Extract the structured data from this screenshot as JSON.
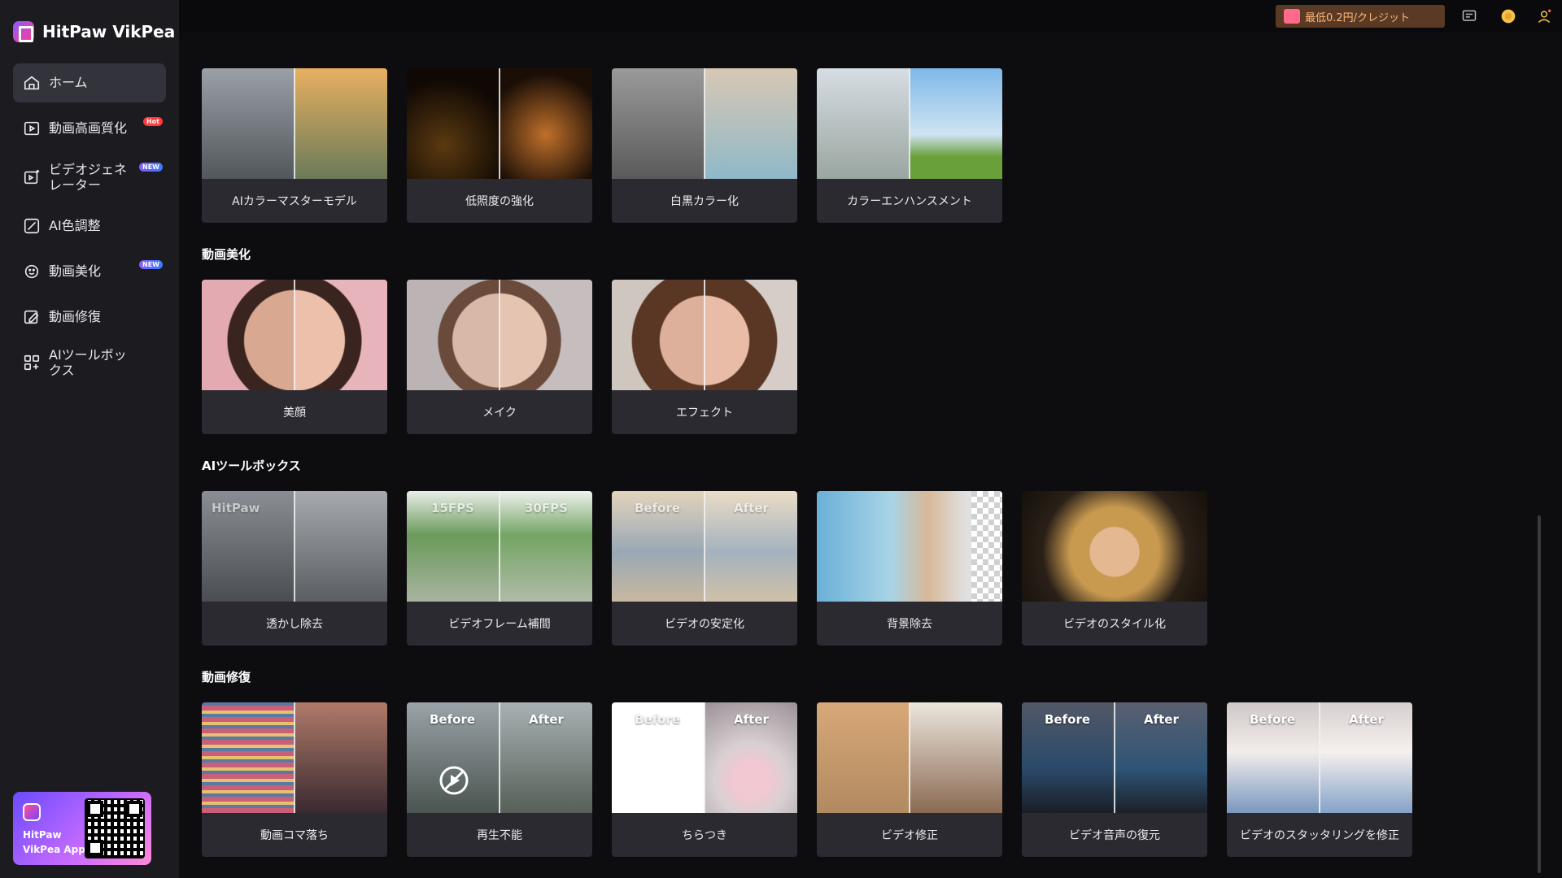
{
  "app": {
    "name": "HitPaw VikPea"
  },
  "sidebar": {
    "items": [
      {
        "label": "ホーム",
        "icon": "home-icon",
        "active": true
      },
      {
        "label": "動画高画質化",
        "icon": "video-enhance-icon",
        "badge": "Hot"
      },
      {
        "label": "ビデオジェネレーター",
        "icon": "video-generator-icon",
        "badge": "NEW"
      },
      {
        "label": "AI色調整",
        "icon": "color-adjust-icon"
      },
      {
        "label": "動画美化",
        "icon": "beautify-icon",
        "badge": "NEW"
      },
      {
        "label": "動画修復",
        "icon": "repair-icon"
      },
      {
        "label": "AIツールボックス",
        "icon": "toolbox-icon"
      }
    ],
    "app_promo": {
      "line1": "HitPaw",
      "line2": "VikPea App"
    }
  },
  "topbar": {
    "promo_text": "最低0.2円/クレジット"
  },
  "sections": [
    {
      "title": "",
      "cards": [
        {
          "label": "AIカラーマスターモデル",
          "left": "#6f7378",
          "right": "#c88a3a"
        },
        {
          "label": "低照度の強化",
          "left": "#1a120a",
          "right": "#3a2410"
        },
        {
          "label": "白黒カラー化",
          "left": "#8b8b8b",
          "right": "#d8d0c4"
        },
        {
          "label": "カラーエンハンスメント",
          "left": "#c7ced6",
          "right": "#8fbfe8"
        }
      ]
    },
    {
      "title": "動画美化",
      "cards": [
        {
          "label": "美顔",
          "left": "#d9a3a8",
          "right": "#e8b4bc"
        },
        {
          "label": "メイク",
          "left": "#c9b8b0",
          "right": "#d6c2b8"
        },
        {
          "label": "エフェクト",
          "left": "#8a6a56",
          "right": "#b08a70"
        }
      ]
    },
    {
      "title": "AIツールボックス",
      "cards": [
        {
          "label": "透かし除去",
          "left": "#6d7076",
          "right": "#8c8f96",
          "tag_left": "HitPaw"
        },
        {
          "label": "ビデオフレーム補間",
          "left": "#7aa06a",
          "right": "#8fb47c",
          "tag_left": "15FPS",
          "tag_right": "30FPS"
        },
        {
          "label": "ビデオの安定化",
          "left": "#b7aa96",
          "right": "#cbbfae",
          "tag_left": "Before",
          "tag_right": "After"
        },
        {
          "label": "背景除去",
          "left": "#7fb7d4",
          "right": "#e6e6e6"
        },
        {
          "label": "ビデオのスタイル化",
          "left": "#3a2a1a",
          "right": "#5a4028"
        }
      ]
    },
    {
      "title": "動画修復",
      "cards": [
        {
          "label": "動画コマ落ち",
          "left": "#7a5a6a",
          "right": "#9a6a5a"
        },
        {
          "label": "再生不能",
          "left": "#6a7470",
          "right": "#7c8680",
          "tag_left": "Before",
          "tag_right": "After"
        },
        {
          "label": "ちらつき",
          "left": "#ffffff",
          "right": "#d7c7cc",
          "tag_left": "Before",
          "tag_right": "After"
        },
        {
          "label": "ビデオ修正",
          "left": "#c9a27a",
          "right": "#e6e0d8"
        },
        {
          "label": "ビデオ音声の復元",
          "left": "#3c4452",
          "right": "#4a5466",
          "tag_left": "Before",
          "tag_right": "After"
        },
        {
          "label": "ビデオのスタッタリングを修正",
          "left": "#d4cfd0",
          "right": "#e2dcdc",
          "tag_left": "Before",
          "tag_right": "After"
        }
      ]
    }
  ]
}
